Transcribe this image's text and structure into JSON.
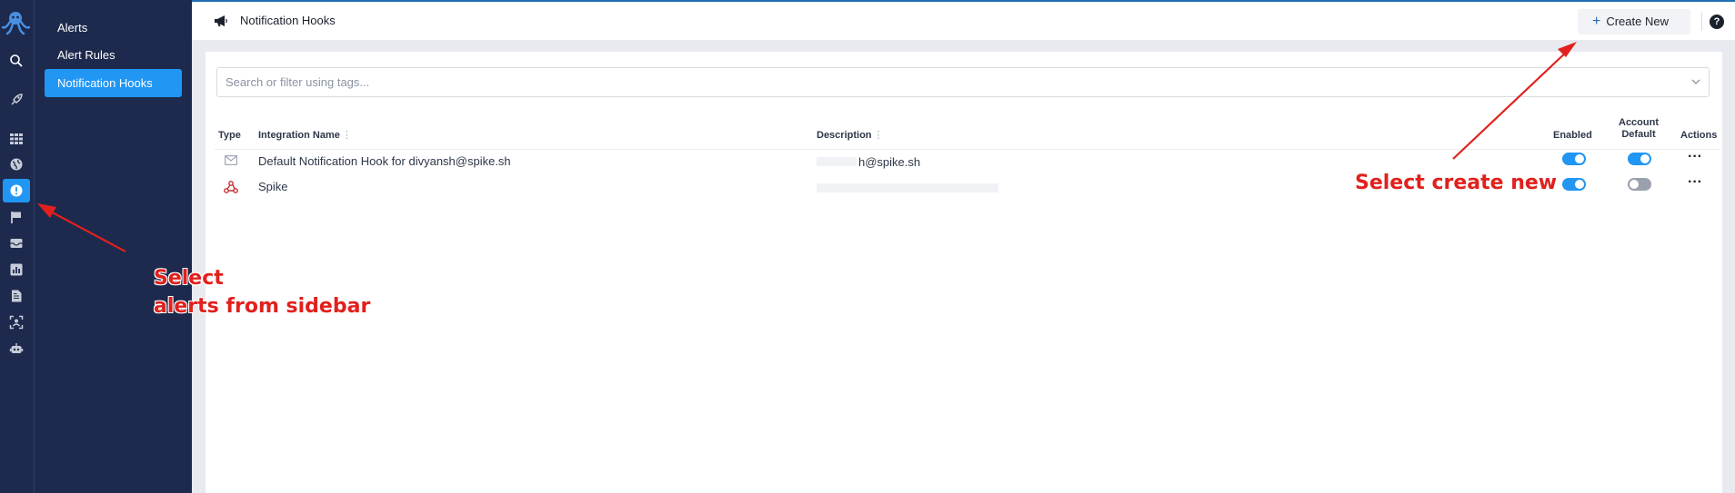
{
  "rail": {
    "icons": [
      "octopus-logo-icon",
      "search-icon",
      "rocket-icon",
      "apps-grid-icon",
      "globe-icon",
      "alert-circle-icon",
      "flag-icon",
      "inbox-icon",
      "bar-chart-icon",
      "document-icon",
      "scan-user-icon",
      "robot-icon"
    ],
    "active": "alert-circle-icon",
    "accent": "#2196f3"
  },
  "subnav": {
    "items": [
      {
        "label": "Alerts"
      },
      {
        "label": "Alert Rules"
      },
      {
        "label": "Notification Hooks",
        "active": true
      }
    ]
  },
  "header": {
    "title": "Notification Hooks",
    "create_label": "Create New",
    "help_label": "?"
  },
  "search": {
    "placeholder": "Search or filter using tags..."
  },
  "table": {
    "columns": {
      "type": "Type",
      "name": "Integration Name",
      "description": "Description",
      "enabled": "Enabled",
      "account_default_1": "Account",
      "account_default_2": "Default",
      "actions": "Actions"
    },
    "rows": [
      {
        "type_icon": "mail-icon",
        "name": "Default Notification Hook for divyansh@spike.sh",
        "description": "h@spike.sh",
        "enabled": true,
        "account_default": true
      },
      {
        "type_icon": "webhook-icon",
        "name": "Spike",
        "description": "",
        "enabled": true,
        "account_default": false
      }
    ]
  },
  "annotations": {
    "create": "Select create new",
    "sidebar_line1": "Select",
    "sidebar_line2": "alerts from sidebar",
    "color": "#e0211d"
  }
}
